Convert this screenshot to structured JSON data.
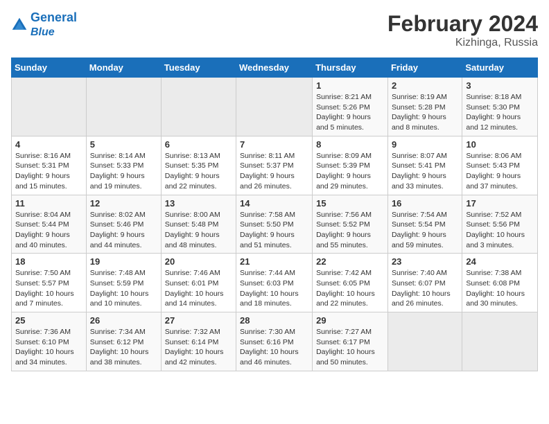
{
  "header": {
    "logo_line1": "General",
    "logo_line2": "Blue",
    "title": "February 2024",
    "subtitle": "Kizhinga, Russia"
  },
  "weekdays": [
    "Sunday",
    "Monday",
    "Tuesday",
    "Wednesday",
    "Thursday",
    "Friday",
    "Saturday"
  ],
  "weeks": [
    [
      {
        "num": "",
        "info": ""
      },
      {
        "num": "",
        "info": ""
      },
      {
        "num": "",
        "info": ""
      },
      {
        "num": "",
        "info": ""
      },
      {
        "num": "1",
        "info": "Sunrise: 8:21 AM\nSunset: 5:26 PM\nDaylight: 9 hours and 5 minutes."
      },
      {
        "num": "2",
        "info": "Sunrise: 8:19 AM\nSunset: 5:28 PM\nDaylight: 9 hours and 8 minutes."
      },
      {
        "num": "3",
        "info": "Sunrise: 8:18 AM\nSunset: 5:30 PM\nDaylight: 9 hours and 12 minutes."
      }
    ],
    [
      {
        "num": "4",
        "info": "Sunrise: 8:16 AM\nSunset: 5:31 PM\nDaylight: 9 hours and 15 minutes."
      },
      {
        "num": "5",
        "info": "Sunrise: 8:14 AM\nSunset: 5:33 PM\nDaylight: 9 hours and 19 minutes."
      },
      {
        "num": "6",
        "info": "Sunrise: 8:13 AM\nSunset: 5:35 PM\nDaylight: 9 hours and 22 minutes."
      },
      {
        "num": "7",
        "info": "Sunrise: 8:11 AM\nSunset: 5:37 PM\nDaylight: 9 hours and 26 minutes."
      },
      {
        "num": "8",
        "info": "Sunrise: 8:09 AM\nSunset: 5:39 PM\nDaylight: 9 hours and 29 minutes."
      },
      {
        "num": "9",
        "info": "Sunrise: 8:07 AM\nSunset: 5:41 PM\nDaylight: 9 hours and 33 minutes."
      },
      {
        "num": "10",
        "info": "Sunrise: 8:06 AM\nSunset: 5:43 PM\nDaylight: 9 hours and 37 minutes."
      }
    ],
    [
      {
        "num": "11",
        "info": "Sunrise: 8:04 AM\nSunset: 5:44 PM\nDaylight: 9 hours and 40 minutes."
      },
      {
        "num": "12",
        "info": "Sunrise: 8:02 AM\nSunset: 5:46 PM\nDaylight: 9 hours and 44 minutes."
      },
      {
        "num": "13",
        "info": "Sunrise: 8:00 AM\nSunset: 5:48 PM\nDaylight: 9 hours and 48 minutes."
      },
      {
        "num": "14",
        "info": "Sunrise: 7:58 AM\nSunset: 5:50 PM\nDaylight: 9 hours and 51 minutes."
      },
      {
        "num": "15",
        "info": "Sunrise: 7:56 AM\nSunset: 5:52 PM\nDaylight: 9 hours and 55 minutes."
      },
      {
        "num": "16",
        "info": "Sunrise: 7:54 AM\nSunset: 5:54 PM\nDaylight: 9 hours and 59 minutes."
      },
      {
        "num": "17",
        "info": "Sunrise: 7:52 AM\nSunset: 5:56 PM\nDaylight: 10 hours and 3 minutes."
      }
    ],
    [
      {
        "num": "18",
        "info": "Sunrise: 7:50 AM\nSunset: 5:57 PM\nDaylight: 10 hours and 7 minutes."
      },
      {
        "num": "19",
        "info": "Sunrise: 7:48 AM\nSunset: 5:59 PM\nDaylight: 10 hours and 10 minutes."
      },
      {
        "num": "20",
        "info": "Sunrise: 7:46 AM\nSunset: 6:01 PM\nDaylight: 10 hours and 14 minutes."
      },
      {
        "num": "21",
        "info": "Sunrise: 7:44 AM\nSunset: 6:03 PM\nDaylight: 10 hours and 18 minutes."
      },
      {
        "num": "22",
        "info": "Sunrise: 7:42 AM\nSunset: 6:05 PM\nDaylight: 10 hours and 22 minutes."
      },
      {
        "num": "23",
        "info": "Sunrise: 7:40 AM\nSunset: 6:07 PM\nDaylight: 10 hours and 26 minutes."
      },
      {
        "num": "24",
        "info": "Sunrise: 7:38 AM\nSunset: 6:08 PM\nDaylight: 10 hours and 30 minutes."
      }
    ],
    [
      {
        "num": "25",
        "info": "Sunrise: 7:36 AM\nSunset: 6:10 PM\nDaylight: 10 hours and 34 minutes."
      },
      {
        "num": "26",
        "info": "Sunrise: 7:34 AM\nSunset: 6:12 PM\nDaylight: 10 hours and 38 minutes."
      },
      {
        "num": "27",
        "info": "Sunrise: 7:32 AM\nSunset: 6:14 PM\nDaylight: 10 hours and 42 minutes."
      },
      {
        "num": "28",
        "info": "Sunrise: 7:30 AM\nSunset: 6:16 PM\nDaylight: 10 hours and 46 minutes."
      },
      {
        "num": "29",
        "info": "Sunrise: 7:27 AM\nSunset: 6:17 PM\nDaylight: 10 hours and 50 minutes."
      },
      {
        "num": "",
        "info": ""
      },
      {
        "num": "",
        "info": ""
      }
    ]
  ]
}
